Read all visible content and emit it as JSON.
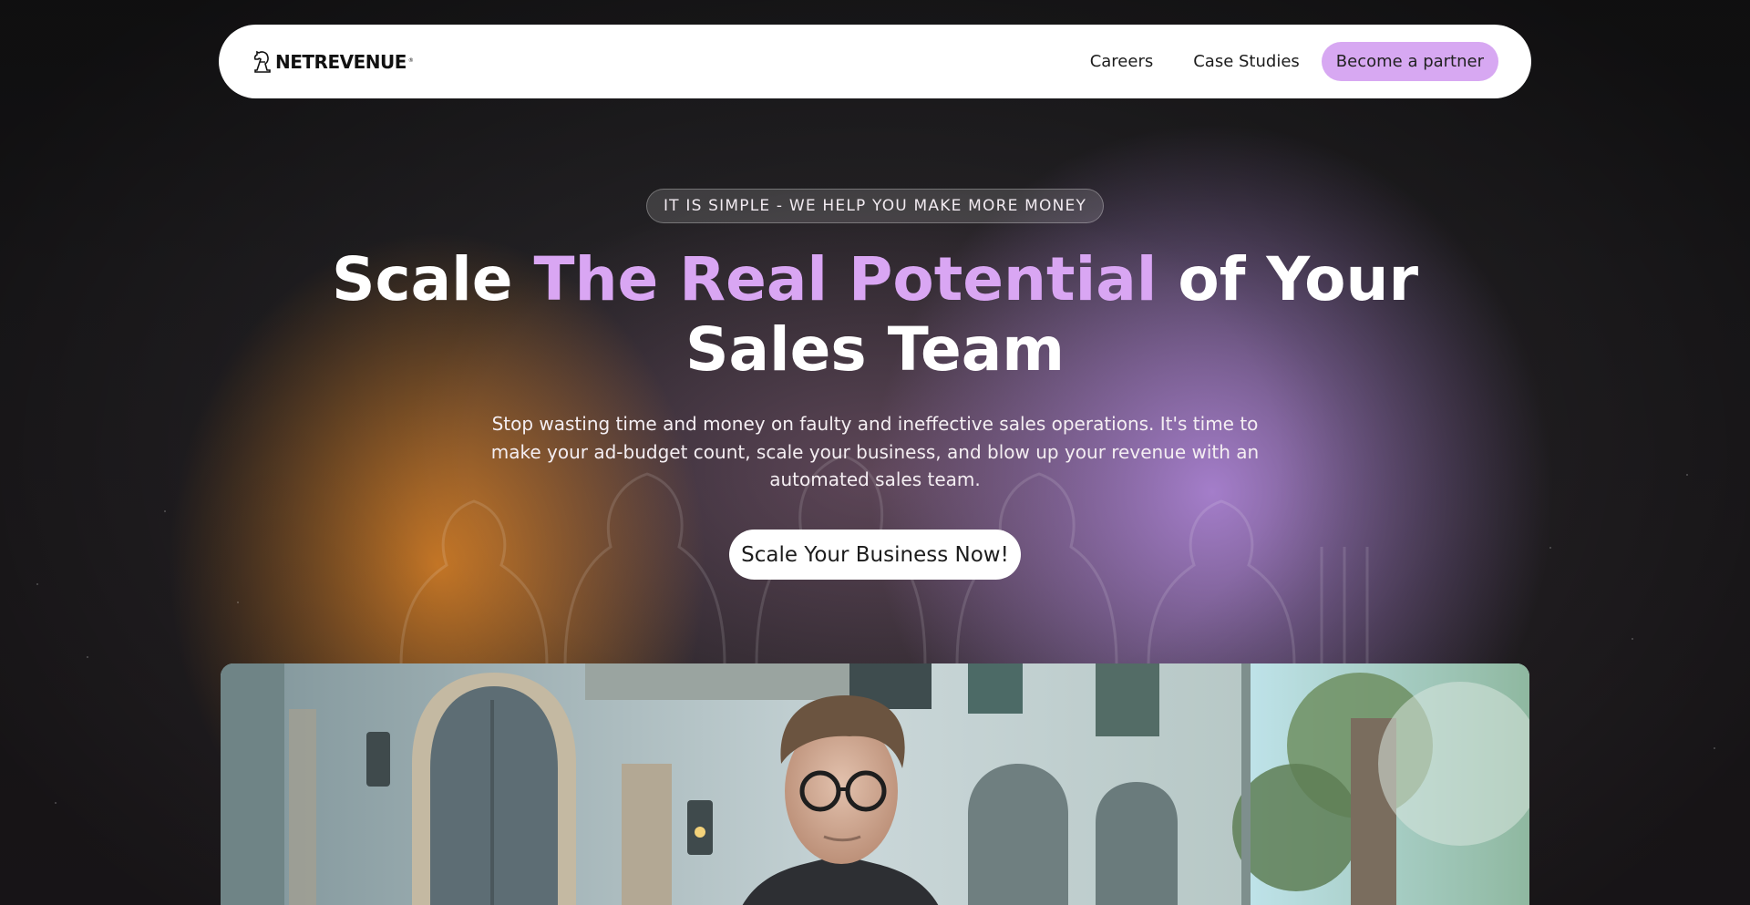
{
  "nav": {
    "logo_text": "NETREVENUE",
    "logo_reg": "®",
    "links": [
      "Careers",
      "Case Studies"
    ],
    "cta_label": "Become a partner"
  },
  "hero": {
    "eyebrow": "IT IS SIMPLE - WE HELP YOU MAKE MORE MONEY",
    "headline_pre": "Scale ",
    "headline_accent": "The Real Potential",
    "headline_post": " of Your Sales Team",
    "subtext": "Stop wasting time and money on faulty and ineffective sales operations. It's time to make your ad-budget count, scale your business, and blow up your revenue with an automated sales team.",
    "cta_label": "Scale Your Business Now!"
  },
  "colors": {
    "accent": "#d9a6f3",
    "nav_cta_bg": "#d7a8f2",
    "page_bg": "#1b1a1c"
  },
  "icons": {
    "logo": "chess-knight-logo-icon"
  }
}
